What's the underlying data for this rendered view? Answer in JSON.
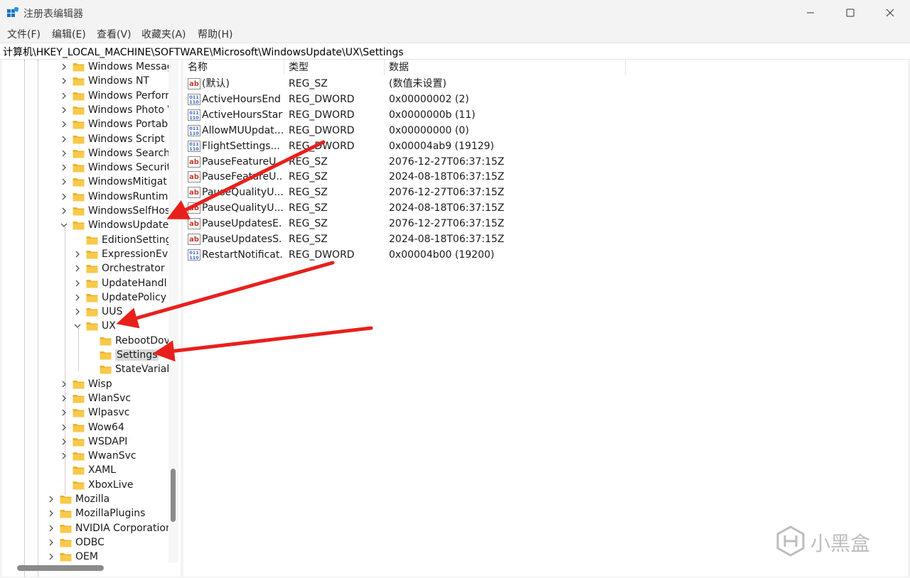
{
  "window": {
    "title": "注册表编辑器",
    "controls": [
      "minimize-icon",
      "maximize-icon",
      "close-icon"
    ]
  },
  "menu": [
    "文件(F)",
    "编辑(E)",
    "查看(V)",
    "收藏夹(A)",
    "帮助(H)"
  ],
  "address": "计算机\\HKEY_LOCAL_MACHINE\\SOFTWARE\\Microsoft\\WindowsUpdate\\UX\\Settings",
  "tree": [
    {
      "label": "Windows Messag",
      "state": "collapsed"
    },
    {
      "label": "Windows NT",
      "state": "collapsed"
    },
    {
      "label": "Windows Perforn",
      "state": "collapsed"
    },
    {
      "label": "Windows Photo V",
      "state": "collapsed"
    },
    {
      "label": "Windows Portab",
      "state": "collapsed"
    },
    {
      "label": "Windows Script H",
      "state": "collapsed"
    },
    {
      "label": "Windows Search",
      "state": "collapsed"
    },
    {
      "label": "Windows Securit",
      "state": "collapsed"
    },
    {
      "label": "WindowsMitigat",
      "state": "collapsed"
    },
    {
      "label": "WindowsRuntim",
      "state": "collapsed"
    },
    {
      "label": "WindowsSelfHos",
      "state": "collapsed"
    },
    {
      "label": "WindowsUpdate",
      "state": "expanded"
    },
    {
      "label": "EditionSetting",
      "state": "leaf"
    },
    {
      "label": "ExpressionEva",
      "state": "collapsed"
    },
    {
      "label": "Orchestrator",
      "state": "collapsed"
    },
    {
      "label": "UpdateHandl",
      "state": "collapsed"
    },
    {
      "label": "UpdatePolicy",
      "state": "collapsed"
    },
    {
      "label": "UUS",
      "state": "collapsed"
    },
    {
      "label": "UX",
      "state": "expanded"
    },
    {
      "label": "RebootDov",
      "state": "leaf"
    },
    {
      "label": "Settings",
      "state": "selected"
    },
    {
      "label": "StateVariab",
      "state": "leaf"
    },
    {
      "label": "Wisp",
      "state": "collapsed"
    },
    {
      "label": "WlanSvc",
      "state": "collapsed"
    },
    {
      "label": "Wlpasvc",
      "state": "collapsed"
    },
    {
      "label": "Wow64",
      "state": "collapsed"
    },
    {
      "label": "WSDAPI",
      "state": "collapsed"
    },
    {
      "label": "WwanSvc",
      "state": "collapsed"
    },
    {
      "label": "XAML",
      "state": "leaf"
    },
    {
      "label": "XboxLive",
      "state": "leaf"
    },
    {
      "label": "Mozilla",
      "state": "collapsed"
    },
    {
      "label": "MozillaPlugins",
      "state": "collapsed"
    },
    {
      "label": "NVIDIA Corporation",
      "state": "collapsed"
    },
    {
      "label": "ODBC",
      "state": "collapsed"
    },
    {
      "label": "OEM",
      "state": "collapsed"
    }
  ],
  "columns": {
    "name": "名称",
    "type": "类型",
    "data": "数据"
  },
  "values": [
    {
      "icon": "string-value-icon",
      "name": "(默认)",
      "type": "REG_SZ",
      "data": "(数值未设置)"
    },
    {
      "icon": "dword-value-icon",
      "name": "ActiveHoursEnd",
      "type": "REG_DWORD",
      "data": "0x00000002 (2)"
    },
    {
      "icon": "dword-value-icon",
      "name": "ActiveHoursStart",
      "type": "REG_DWORD",
      "data": "0x0000000b (11)"
    },
    {
      "icon": "dword-value-icon",
      "name": "AllowMUUpdat...",
      "type": "REG_DWORD",
      "data": "0x00000000 (0)"
    },
    {
      "icon": "dword-value-icon",
      "name": "FlightSettings...",
      "type": "REG_DWORD",
      "data": "0x00004ab9 (19129)"
    },
    {
      "icon": "string-value-icon",
      "name": "PauseFeatureU...",
      "type": "REG_SZ",
      "data": "2076-12-27T06:37:15Z"
    },
    {
      "icon": "string-value-icon",
      "name": "PauseFeatureU...",
      "type": "REG_SZ",
      "data": "2024-08-18T06:37:15Z"
    },
    {
      "icon": "string-value-icon",
      "name": "PauseQualityU...",
      "type": "REG_SZ",
      "data": "2076-12-27T06:37:15Z"
    },
    {
      "icon": "string-value-icon",
      "name": "PauseQualityU...",
      "type": "REG_SZ",
      "data": "2024-08-18T06:37:15Z"
    },
    {
      "icon": "string-value-icon",
      "name": "PauseUpdatesE...",
      "type": "REG_SZ",
      "data": "2076-12-27T06:37:15Z"
    },
    {
      "icon": "string-value-icon",
      "name": "PauseUpdatesS...",
      "type": "REG_SZ",
      "data": "2024-08-18T06:37:15Z"
    },
    {
      "icon": "dword-value-icon",
      "name": "RestartNotificat...",
      "type": "REG_DWORD",
      "data": "0x00004b00 (19200)"
    }
  ],
  "watermark": "小黑盒",
  "colors": {
    "folder": "#f8c94a",
    "arrow": "#e8201c",
    "dword_icon": "#3a62c4",
    "string_icon": "#c0392b"
  }
}
